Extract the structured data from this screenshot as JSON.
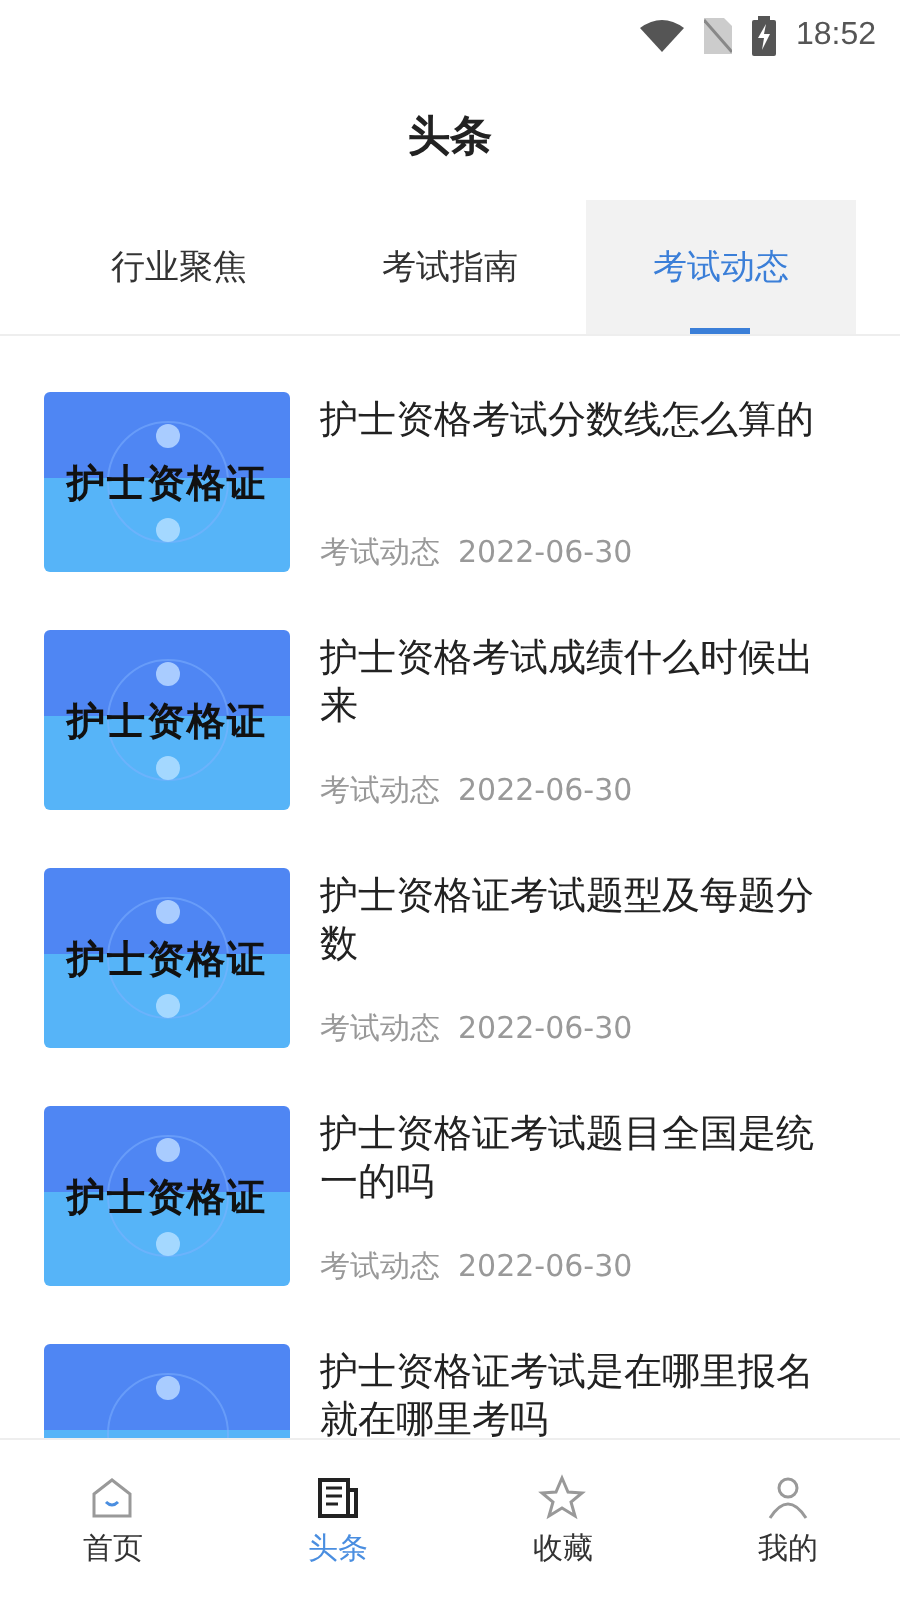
{
  "status_bar": {
    "time": "18:52"
  },
  "header": {
    "title": "头条"
  },
  "tabs": [
    {
      "label": "行业聚焦",
      "selected": false
    },
    {
      "label": "考试指南",
      "selected": false
    },
    {
      "label": "考试动态",
      "selected": true
    }
  ],
  "articles": [
    {
      "thumb_text": "护士资格证",
      "title": "护士资格考试分数线怎么算的",
      "category": "考试动态",
      "date": "2022-06-30"
    },
    {
      "thumb_text": "护士资格证",
      "title": "护士资格考试成绩什么时候出来",
      "category": "考试动态",
      "date": "2022-06-30"
    },
    {
      "thumb_text": "护士资格证",
      "title": "护士资格证考试题型及每题分数",
      "category": "考试动态",
      "date": "2022-06-30"
    },
    {
      "thumb_text": "护士资格证",
      "title": "护士资格证考试题目全国是统一的吗",
      "category": "考试动态",
      "date": "2022-06-30"
    },
    {
      "title": "护士资格证考试是在哪里报名就在哪里考吗"
    }
  ],
  "bottom_nav": [
    {
      "kind": "home",
      "label": "首页",
      "selected": false
    },
    {
      "kind": "news",
      "label": "头条",
      "selected": true
    },
    {
      "kind": "star",
      "label": "收藏",
      "selected": false
    },
    {
      "kind": "person",
      "label": "我的",
      "selected": false
    }
  ]
}
